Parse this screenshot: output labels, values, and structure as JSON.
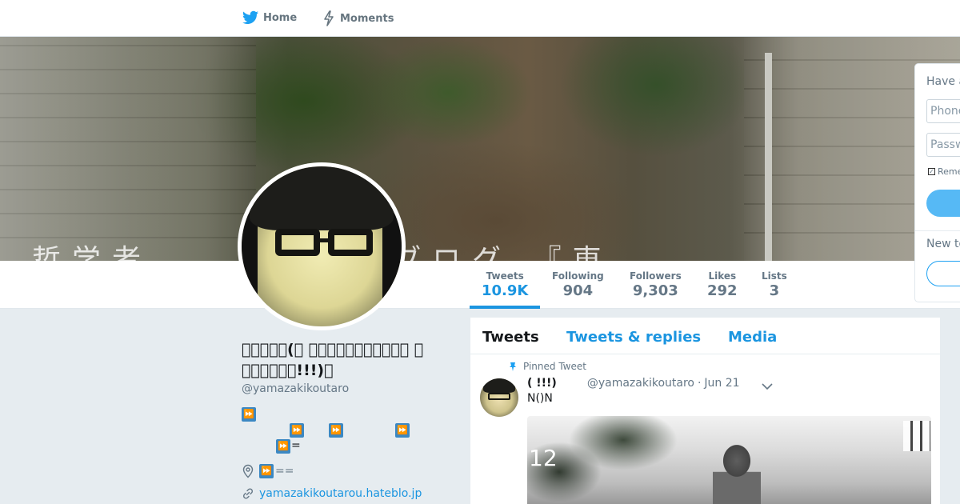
{
  "nav": {
    "home_label": "Home",
    "moments_label": "Moments"
  },
  "banner": {
    "caption_text": "哲学者　　　太郎のブログ 『東"
  },
  "stats": {
    "tweets": {
      "label": "Tweets",
      "value": "10.9K"
    },
    "following": {
      "label": "Following",
      "value": "904"
    },
    "followers": {
      "label": "Followers",
      "value": "9,303"
    },
    "likes": {
      "label": "Likes",
      "value": "292"
    },
    "lists": {
      "label": "Lists",
      "value": "3"
    }
  },
  "profile": {
    "name": "􀀀􀀀􀀀􀀀􀀀(􀀀 􀀀􀀀􀀀􀀀􀀀􀀀􀀀􀀀􀀀􀀀􀀀 􀀀 􀀀􀀀􀀀􀀀􀀀􀀀!!!)􀀀",
    "handle": "@yamazakikoutaro",
    "bio_tail_1": "=",
    "location": "==",
    "url": "yamazakikoutarou.hateblo.jp"
  },
  "timeline": {
    "tabs": {
      "tweets": "Tweets",
      "replies": "Tweets & replies",
      "media": "Media"
    },
    "pinned_label": "Pinned Tweet",
    "tweet": {
      "name": "(   !!!)",
      "handle": "@yamazakikoutaro",
      "dot": "·",
      "date": "Jun 21",
      "text": "N()N",
      "media_number": "12"
    }
  },
  "login": {
    "have_account": "Have an account?",
    "phone_placeholder": "Phone, email or username",
    "password_placeholder": "Password",
    "remember": "Remember me",
    "new_to": "New to Twitter?"
  },
  "colors": {
    "accent": "#1b95e0",
    "emoji_box": "#3b88c3"
  },
  "icons": {
    "home": "bird-icon",
    "moments": "lightning-icon",
    "bio_emoji": "fast-forward-icon",
    "location": "location-pin-icon",
    "url": "link-icon",
    "pinned": "pin-icon",
    "caret": "chevron-down-icon"
  }
}
